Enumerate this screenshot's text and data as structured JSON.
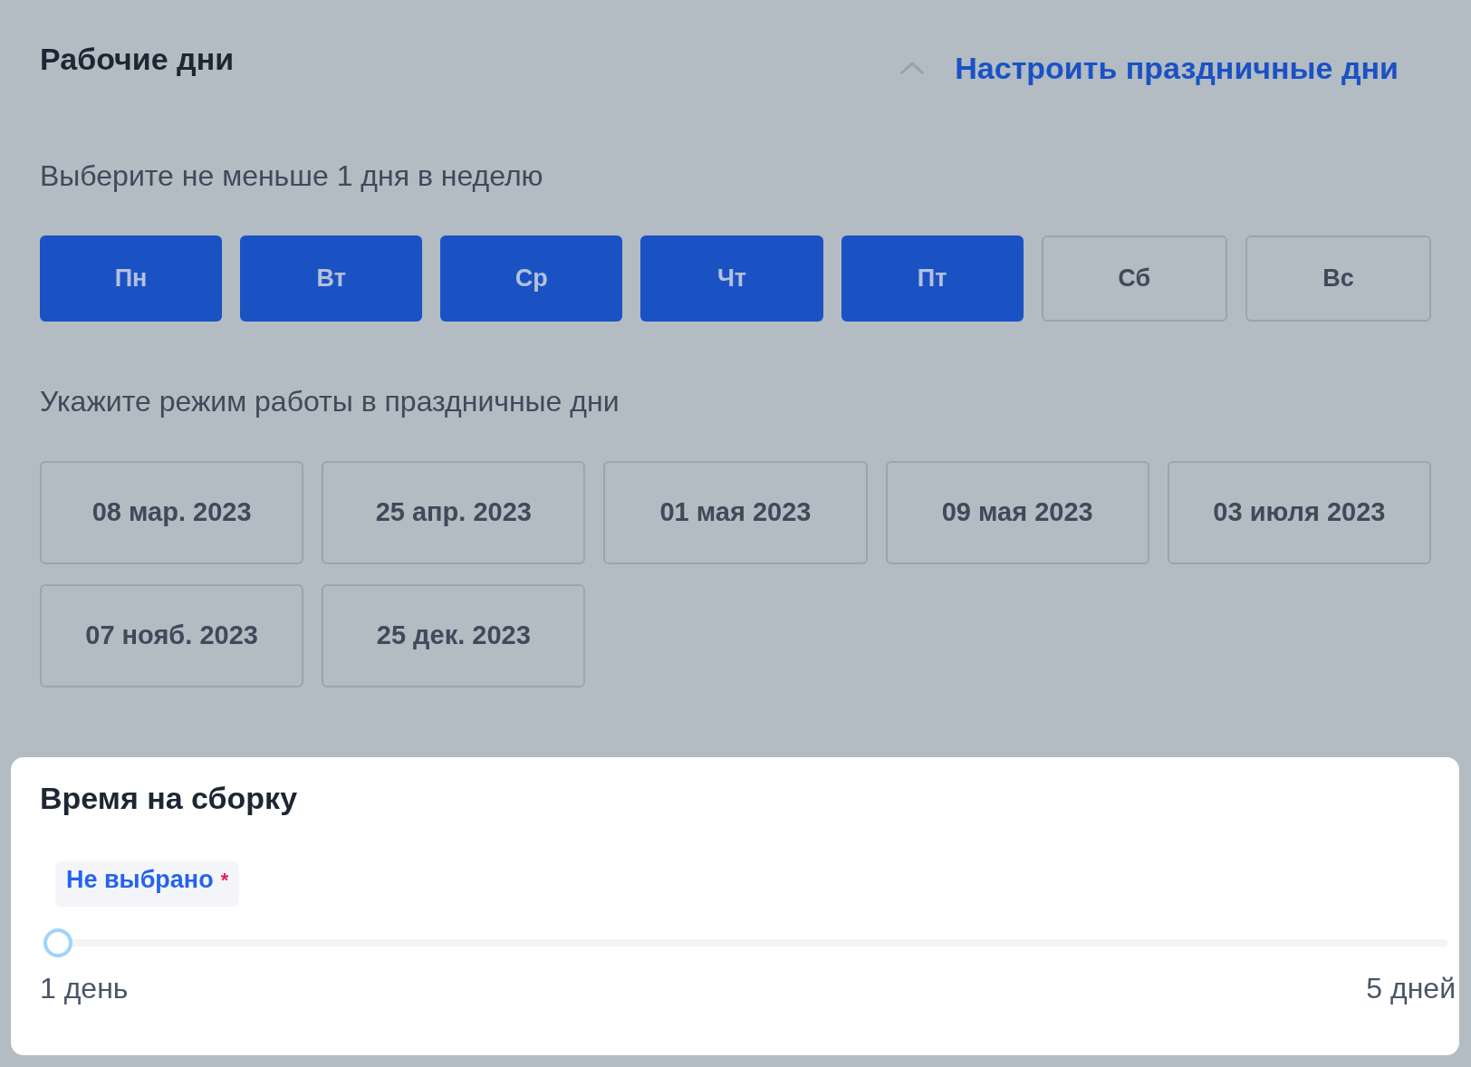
{
  "working_days": {
    "title": "Рабочие дни",
    "holidays_link": "Настроить праздничные дни",
    "expanded": true,
    "days_hint": "Выберите не меньше 1 дня в неделю",
    "days": [
      {
        "label": "Пн",
        "selected": true
      },
      {
        "label": "Вт",
        "selected": true
      },
      {
        "label": "Ср",
        "selected": true
      },
      {
        "label": "Чт",
        "selected": true
      },
      {
        "label": "Пт",
        "selected": true
      },
      {
        "label": "Сб",
        "selected": false
      },
      {
        "label": "Вс",
        "selected": false
      }
    ],
    "holidays_hint": "Укажите режим работы в праздничные дни",
    "holidays": [
      {
        "label": "08 мар. 2023"
      },
      {
        "label": "25 апр. 2023"
      },
      {
        "label": "01 мая 2023"
      },
      {
        "label": "09 мая 2023"
      },
      {
        "label": "03 июля 2023"
      },
      {
        "label": "07 нояб. 2023"
      },
      {
        "label": "25 дек. 2023"
      }
    ]
  },
  "assembly_time": {
    "title": "Время на сборку",
    "value_label": "Не выбрано",
    "required_mark": "*",
    "level": 0,
    "min_label": "1 день",
    "max_label": "5 дней"
  }
}
